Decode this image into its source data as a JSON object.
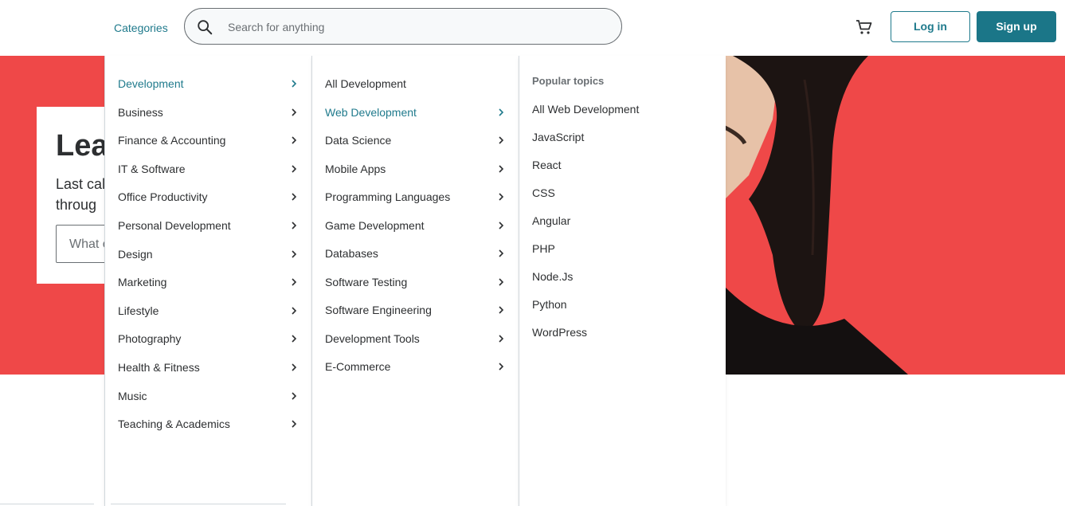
{
  "header": {
    "categories_label": "Categories",
    "search_placeholder": "Search for anything",
    "login_label": "Log in",
    "signup_label": "Sign up",
    "cart_icon": "shopping-cart-icon",
    "search_icon": "magnifier-icon"
  },
  "hero": {
    "title": "Lea",
    "subtitle_line1": "Last cal",
    "subtitle_line2": "throug",
    "input_placeholder": "What c",
    "bg_color": "#ef4848"
  },
  "menu": {
    "categories": [
      {
        "label": "Development",
        "active": true
      },
      {
        "label": "Business"
      },
      {
        "label": "Finance & Accounting"
      },
      {
        "label": "IT & Software"
      },
      {
        "label": "Office Productivity"
      },
      {
        "label": "Personal Development"
      },
      {
        "label": "Design"
      },
      {
        "label": "Marketing"
      },
      {
        "label": "Lifestyle"
      },
      {
        "label": "Photography"
      },
      {
        "label": "Health & Fitness"
      },
      {
        "label": "Music"
      },
      {
        "label": "Teaching & Academics"
      }
    ],
    "subcategories": [
      {
        "label": "All Development",
        "chevron": false
      },
      {
        "label": "Web Development",
        "active": true
      },
      {
        "label": "Data Science"
      },
      {
        "label": "Mobile Apps"
      },
      {
        "label": "Programming Languages"
      },
      {
        "label": "Game Development"
      },
      {
        "label": "Databases"
      },
      {
        "label": "Software Testing"
      },
      {
        "label": "Software Engineering"
      },
      {
        "label": "Development Tools"
      },
      {
        "label": "E-Commerce"
      }
    ],
    "popular_heading": "Popular topics",
    "topics": [
      "All Web Development",
      "JavaScript",
      "React",
      "CSS",
      "Angular",
      "PHP",
      "Node.Js",
      "Python",
      "WordPress"
    ]
  },
  "colors": {
    "accent": "#1f7a8c",
    "signup_bg": "#1b7688",
    "text": "#2d2f31",
    "muted": "#6a6f73"
  }
}
